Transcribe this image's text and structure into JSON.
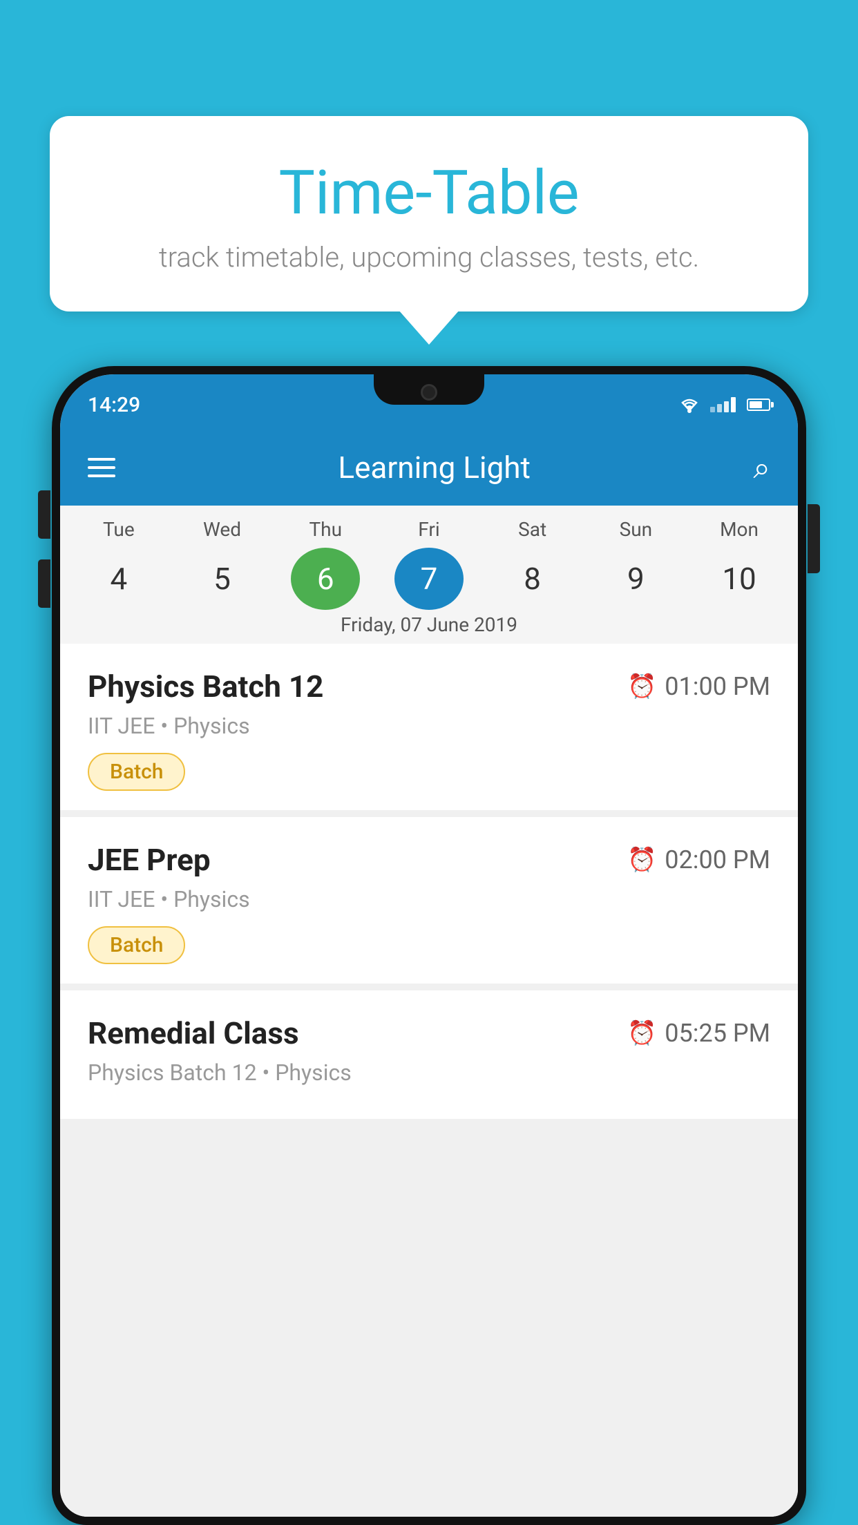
{
  "background": {
    "color": "#29b6d8"
  },
  "tooltip": {
    "title": "Time-Table",
    "subtitle": "track timetable, upcoming classes, tests, etc."
  },
  "phone": {
    "statusBar": {
      "time": "14:29"
    },
    "appBar": {
      "title": "Learning Light"
    },
    "calendar": {
      "days": [
        "Tue",
        "Wed",
        "Thu",
        "Fri",
        "Sat",
        "Sun",
        "Mon"
      ],
      "dates": [
        "4",
        "5",
        "6",
        "7",
        "8",
        "9",
        "10"
      ],
      "todayIndex": 2,
      "selectedIndex": 3,
      "selectedDateLabel": "Friday, 07 June 2019"
    },
    "schedule": [
      {
        "title": "Physics Batch 12",
        "time": "01:00 PM",
        "subtitle": "IIT JEE • Physics",
        "badge": "Batch"
      },
      {
        "title": "JEE Prep",
        "time": "02:00 PM",
        "subtitle": "IIT JEE • Physics",
        "badge": "Batch"
      },
      {
        "title": "Remedial Class",
        "time": "05:25 PM",
        "subtitle": "Physics Batch 12 • Physics",
        "badge": ""
      }
    ]
  }
}
